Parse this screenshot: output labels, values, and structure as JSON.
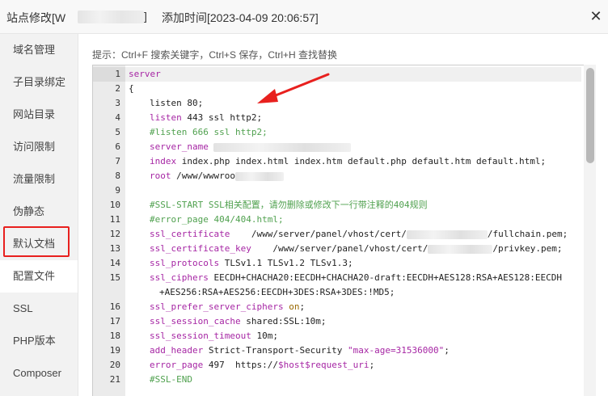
{
  "titlebar": {
    "prefix": "站点修改[W",
    "bracket": "]",
    "added_time": "添加时间[2023-04-09 20:06:57]",
    "close_glyph": "✕"
  },
  "sidebar": {
    "items": [
      {
        "label": "域名管理"
      },
      {
        "label": "子目录绑定"
      },
      {
        "label": "网站目录"
      },
      {
        "label": "访问限制"
      },
      {
        "label": "流量限制"
      },
      {
        "label": "伪静态"
      },
      {
        "label": "默认文档"
      },
      {
        "label": "配置文件"
      },
      {
        "label": "SSL"
      },
      {
        "label": "PHP版本"
      },
      {
        "label": "Composer"
      }
    ],
    "active_index": 7
  },
  "hint": "提示：Ctrl+F 搜索关键字，Ctrl+S 保存，Ctrl+H 查找替换",
  "editor": {
    "line_numbers": [
      "1",
      "2",
      "3",
      "4",
      "5",
      "6",
      "7",
      "8",
      "9",
      "10",
      "11",
      "12",
      "13",
      "14",
      "15",
      "16",
      "17",
      "18",
      "19",
      "20",
      "21"
    ],
    "l1": "server",
    "l2": "{",
    "l3_kw": "listen",
    "l3_rest": " 80;",
    "l4_kw": "listen",
    "l4_rest": " 443 ssl http2;",
    "l5": "#listen 666 ssl http2;",
    "l6_kw": "server_name",
    "l6_rest": " ",
    "l7_kw": "index",
    "l7_rest": " index.php index.html index.htm default.php default.htm default.html;",
    "l8_kw": "root",
    "l8_rest": " /www/wwwroo",
    "l10": "#SSL-START SSL相关配置，请勿删除或修改下一行带注释的404规则",
    "l11": "#error_page 404/404.html;",
    "l12_kw": "ssl_certificate",
    "l12_rest": "    /www/server/panel/vhost/cert/",
    "l12_tail": "/fullchain.pem;",
    "l13_kw": "ssl_certificate_key",
    "l13_rest": "    /www/server/panel/vhost/cert/",
    "l13_tail": "/privkey.pem;",
    "l14_kw": "ssl_protocols",
    "l14_rest": " TLSv1.1 TLSv1.2 TLSv1.3;",
    "l15_kw": "ssl_ciphers",
    "l15_rest": " EECDH+CHACHA20:EECDH+CHACHA20-draft:EECDH+AES128:RSA+AES128:EECDH",
    "l15_cont": "+AES256:RSA+AES256:EECDH+3DES:RSA+3DES:!MD5;",
    "l16_kw": "ssl_prefer_server_ciphers",
    "l16_val": " on",
    "l16_end": ";",
    "l17_kw": "ssl_session_cache",
    "l17_rest": " shared:SSL:10m;",
    "l18_kw": "ssl_session_timeout",
    "l18_rest": " 10m;",
    "l19_kw": "add_header",
    "l19_rest": " Strict-Transport-Security ",
    "l19_str": "\"max-age=31536000\"",
    "l19_end": ";",
    "l20_kw": "error_page",
    "l20_rest": " 497  https://",
    "l20_var1": "$host",
    "l20_var2": "$request_uri",
    "l20_end": ";",
    "l21": "#SSL-END"
  },
  "colors": {
    "keyword": "#a626a4",
    "directive": "#4078f2",
    "comment": "#50a14f",
    "highlight_box": "#e8201e",
    "arrow": "#e8201e"
  },
  "icons": {
    "close": "close-icon",
    "arrow": "red-arrow-annotation-icon"
  }
}
